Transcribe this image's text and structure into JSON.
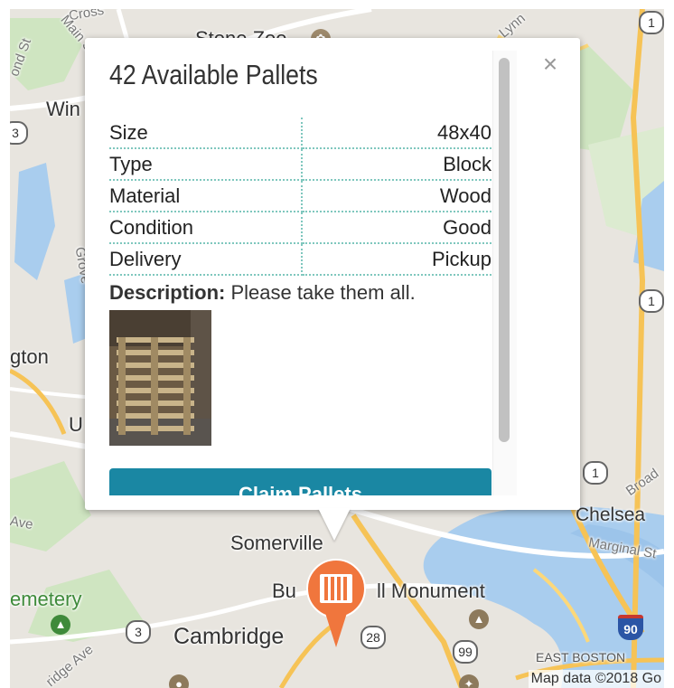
{
  "map": {
    "labels": {
      "cross": "Cross",
      "main_st": "Main St",
      "stone_zoo": "Stone Zoo",
      "lynn": "Lynn",
      "ond_st": "ond St",
      "win": "Win",
      "grove": "Grove",
      "gton": "gton",
      "u": "U",
      "ave": "Ave",
      "somerville": "Somerville",
      "chelsea": "Chelsea",
      "marginal": "Marginal St",
      "broad": "Broad",
      "cemetery": "emetery",
      "bunker_hill_a": "Bu",
      "bunker_hill_b": "ll Monument",
      "cambridge": "Cambridge",
      "east_boston": "EAST BOSTON",
      "ridge_ave": "ridge Ave"
    },
    "shields": {
      "r1_top": "1",
      "r1_mid": "1",
      "r1_low": "1",
      "r3_left": "3",
      "r3_cambridge": "3",
      "r28": "28",
      "r99": "99",
      "i90": "90"
    },
    "attribution": "Map data ©2018 Go"
  },
  "popup": {
    "title": "42 Available Pallets",
    "close_label": "×",
    "details": [
      {
        "label": "Size",
        "value": "48x40"
      },
      {
        "label": "Type",
        "value": "Block"
      },
      {
        "label": "Material",
        "value": "Wood"
      },
      {
        "label": "Condition",
        "value": "Good"
      },
      {
        "label": "Delivery",
        "value": "Pickup"
      }
    ],
    "description_label": "Description:",
    "description_text": " Please take them all.",
    "claim_button": "Claim Pallets"
  },
  "colors": {
    "accent": "#1a87a3",
    "marker": "#f0763d",
    "table_divider": "#7fc7be"
  }
}
